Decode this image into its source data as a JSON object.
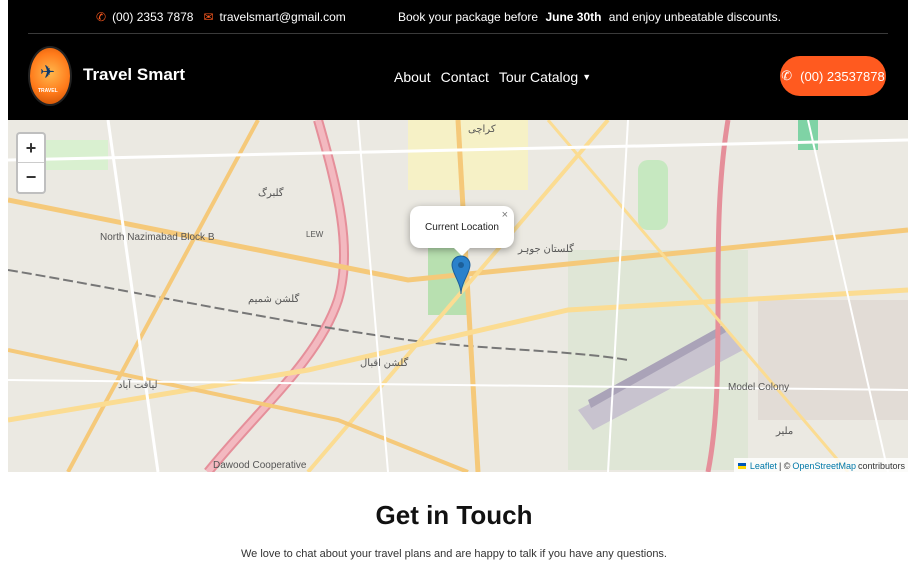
{
  "topbar": {
    "phone": "(00) 2353 7878",
    "email": "travelsmart@gmail.com",
    "promo_before": "Book your package before",
    "promo_date": "June 30th",
    "promo_after": "and enjoy unbeatable discounts.",
    "phone_icon": "phone-icon",
    "email_icon": "envelope-icon"
  },
  "navbar": {
    "logo_text": "TRAVEL",
    "brand": "Travel Smart",
    "links": [
      "About",
      "Contact",
      "Tour Catalog"
    ],
    "call_button": "(00) 23537878",
    "accent": "#ff5a1f"
  },
  "map": {
    "zoom_in": "+",
    "zoom_out": "−",
    "popup_text": "Current Location",
    "popup_close": "×",
    "attribution_leaflet": "Leaflet",
    "attribution_sep": "| ©",
    "attribution_osm": "OpenStreetMap",
    "attribution_contrib": "contributors",
    "labels": [
      "North Nazimabad Block B",
      "گلبرگ",
      "گلشن شمیم",
      "گلستان جوہر",
      "گلشن اقبال",
      "لیاقت آباد",
      "کراچی",
      "Model Colony",
      "Dawood Cooperative",
      "LEW",
      "ملیر"
    ]
  },
  "section": {
    "heading": "Get in Touch",
    "subtitle": "We love to chat about your travel plans and are happy to talk if you have any questions."
  }
}
